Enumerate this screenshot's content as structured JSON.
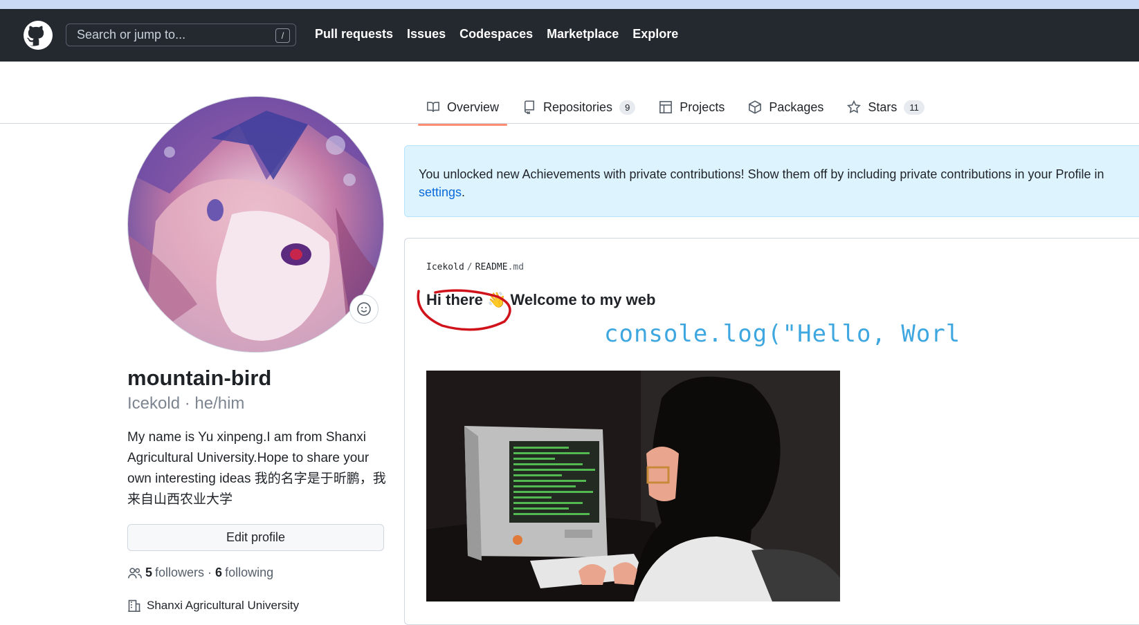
{
  "header": {
    "search_placeholder": "Search or jump to...",
    "search_shortcut": "/",
    "nav": [
      "Pull requests",
      "Issues",
      "Codespaces",
      "Marketplace",
      "Explore"
    ]
  },
  "tabs": [
    {
      "label": "Overview",
      "icon": "book-icon",
      "active": true
    },
    {
      "label": "Repositories",
      "icon": "repo-icon",
      "count": "9"
    },
    {
      "label": "Projects",
      "icon": "table-icon"
    },
    {
      "label": "Packages",
      "icon": "package-icon"
    },
    {
      "label": "Stars",
      "icon": "star-icon",
      "count": "11"
    }
  ],
  "profile": {
    "name": "mountain-bird",
    "login_line": "Icekold · he/him",
    "bio": "My name is Yu xinpeng.I am from Shanxi Agricultural University.Hope to share your own interesting ideas 我的名字是于昕鹏，我来自山西农业大学",
    "edit_button": "Edit profile",
    "followers_count": "5",
    "followers_label": "followers",
    "dot": " · ",
    "following_count": "6",
    "following_label": "following",
    "organization": "Shanxi Agricultural University"
  },
  "flash": {
    "text": "You unlocked new Achievements with private contributions! Show them off by including private contributions in your Profile in",
    "link": "settings",
    "tail": "."
  },
  "readme": {
    "owner": "Icekold",
    "sep": "/",
    "file": "README",
    "ext": ".md",
    "greeting": "Hi there 👋 Welcome to my web",
    "console": "console.log(\"Hello, Worl"
  },
  "colors": {
    "header_bg": "#24292f",
    "accent_tab": "#fd8c73",
    "link": "#0969da",
    "console_text": "#3fa7e0",
    "annotation_red": "#d0131b"
  }
}
